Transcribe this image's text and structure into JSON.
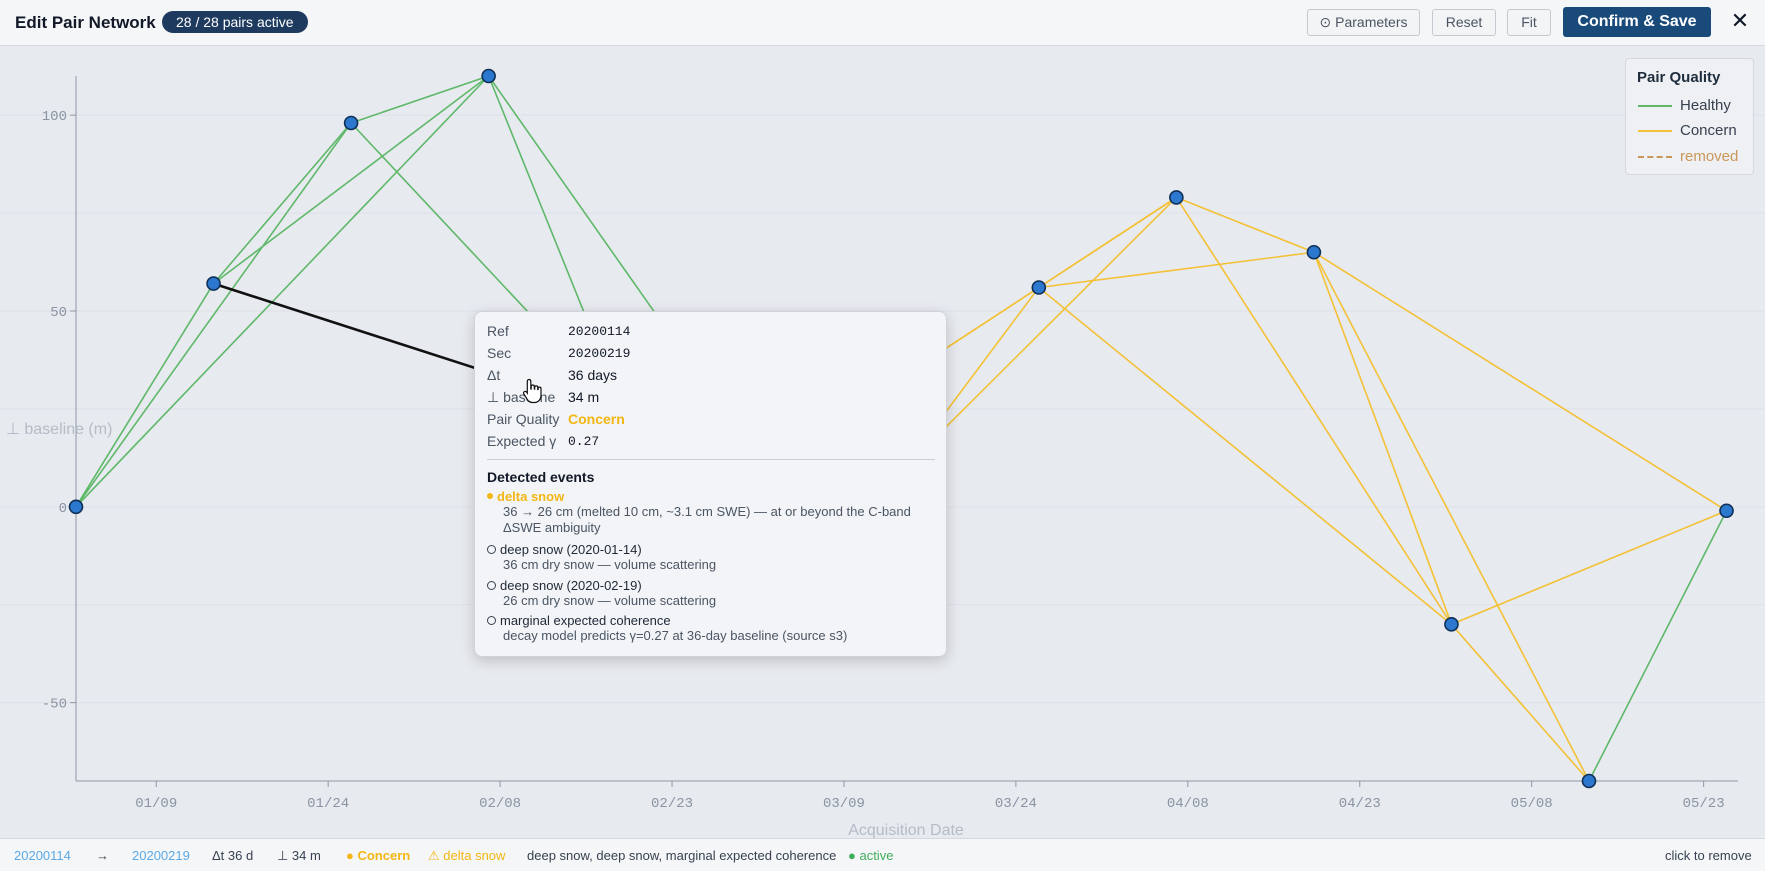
{
  "header": {
    "title": "Edit Pair Network",
    "badge": "28 / 28 pairs active",
    "parameters_label": "⊙ Parameters",
    "reset_label": "Reset",
    "fit_label": "Fit",
    "confirm_label": "Confirm & Save",
    "close_label": "✕"
  },
  "colors": {
    "healthy": "#5fb86a",
    "concern": "#f4c136",
    "removed": "#c9975a",
    "node_fill": "#2c78cf",
    "node_stroke": "#0f2f57",
    "selected_edge": "#111111",
    "confirm_button": "#1a4a7a"
  },
  "legend": {
    "title": "Pair Quality",
    "items": [
      {
        "label": "Healthy",
        "color": "#5fb86a",
        "style": "solid"
      },
      {
        "label": "Concern",
        "color": "#f4c136",
        "style": "solid"
      },
      {
        "label": "removed",
        "color": "#c9975a",
        "style": "dashed"
      }
    ]
  },
  "chart_data": {
    "type": "network",
    "xlabel": "Acquisition Date",
    "ylabel": "⊥ baseline (m)",
    "x_ticks": [
      "01/09",
      "01/24",
      "02/08",
      "02/23",
      "03/09",
      "03/24",
      "04/08",
      "04/23",
      "05/08",
      "05/23"
    ],
    "y_ticks": [
      -50,
      0,
      50,
      100
    ],
    "ylim": [
      -70,
      110
    ],
    "x_domain": [
      "2020-01-02",
      "2020-05-26"
    ],
    "grid": true,
    "nodes": [
      {
        "date": "2020-01-02",
        "baseline": 0
      },
      {
        "date": "2020-01-14",
        "baseline": 57
      },
      {
        "date": "2020-01-26",
        "baseline": 98
      },
      {
        "date": "2020-02-07",
        "baseline": 110
      },
      {
        "date": "2020-02-19",
        "baseline": 23
      },
      {
        "date": "2020-03-02",
        "baseline": 10
      },
      {
        "date": "2020-03-14",
        "baseline": 9
      },
      {
        "date": "2020-03-26",
        "baseline": 56
      },
      {
        "date": "2020-04-07",
        "baseline": 79
      },
      {
        "date": "2020-04-19",
        "baseline": 65
      },
      {
        "date": "2020-05-01",
        "baseline": -30
      },
      {
        "date": "2020-05-13",
        "baseline": -70
      },
      {
        "date": "2020-05-25",
        "baseline": -1
      }
    ],
    "edges": [
      {
        "ref": "2020-01-02",
        "sec": "2020-01-14",
        "quality": "healthy"
      },
      {
        "ref": "2020-01-02",
        "sec": "2020-01-26",
        "quality": "healthy"
      },
      {
        "ref": "2020-01-02",
        "sec": "2020-02-07",
        "quality": "healthy"
      },
      {
        "ref": "2020-01-14",
        "sec": "2020-01-26",
        "quality": "healthy"
      },
      {
        "ref": "2020-01-14",
        "sec": "2020-02-07",
        "quality": "healthy"
      },
      {
        "ref": "2020-01-14",
        "sec": "2020-02-19",
        "quality": "concern",
        "selected": true
      },
      {
        "ref": "2020-01-26",
        "sec": "2020-02-07",
        "quality": "healthy"
      },
      {
        "ref": "2020-01-26",
        "sec": "2020-02-19",
        "quality": "healthy"
      },
      {
        "ref": "2020-02-07",
        "sec": "2020-02-19",
        "quality": "healthy"
      },
      {
        "ref": "2020-02-07",
        "sec": "2020-03-02",
        "quality": "healthy"
      },
      {
        "ref": "2020-02-19",
        "sec": "2020-03-02",
        "quality": "healthy"
      },
      {
        "ref": "2020-02-19",
        "sec": "2020-03-14",
        "quality": "healthy"
      },
      {
        "ref": "2020-03-02",
        "sec": "2020-03-14",
        "quality": "concern"
      },
      {
        "ref": "2020-03-02",
        "sec": "2020-03-26",
        "quality": "concern"
      },
      {
        "ref": "2020-03-14",
        "sec": "2020-03-26",
        "quality": "concern"
      },
      {
        "ref": "2020-03-14",
        "sec": "2020-04-07",
        "quality": "concern"
      },
      {
        "ref": "2020-03-02",
        "sec": "2020-04-07",
        "quality": "concern"
      },
      {
        "ref": "2020-03-26",
        "sec": "2020-04-07",
        "quality": "concern"
      },
      {
        "ref": "2020-03-26",
        "sec": "2020-04-19",
        "quality": "concern"
      },
      {
        "ref": "2020-03-26",
        "sec": "2020-05-01",
        "quality": "concern"
      },
      {
        "ref": "2020-04-07",
        "sec": "2020-04-19",
        "quality": "concern"
      },
      {
        "ref": "2020-04-07",
        "sec": "2020-05-01",
        "quality": "concern"
      },
      {
        "ref": "2020-04-19",
        "sec": "2020-05-01",
        "quality": "concern"
      },
      {
        "ref": "2020-04-19",
        "sec": "2020-05-13",
        "quality": "concern"
      },
      {
        "ref": "2020-04-19",
        "sec": "2020-05-25",
        "quality": "concern"
      },
      {
        "ref": "2020-05-01",
        "sec": "2020-05-13",
        "quality": "concern"
      },
      {
        "ref": "2020-05-01",
        "sec": "2020-05-25",
        "quality": "concern"
      },
      {
        "ref": "2020-05-13",
        "sec": "2020-05-25",
        "quality": "healthy"
      }
    ]
  },
  "tooltip": {
    "ref_key": "Ref",
    "ref_val": "20200114",
    "sec_key": "Sec",
    "sec_val": "20200219",
    "dt_key": "Δt",
    "dt_val": "36 days",
    "bperp_key": "⊥ baseline",
    "bperp_val": "34 m",
    "quality_key": "Pair Quality",
    "quality_val": "Concern",
    "coh_key": "Expected γ",
    "coh_val": "0.27",
    "events_title": "Detected events",
    "events": [
      {
        "title": "delta snow",
        "detail": "36 → 26 cm (melted 10 cm, ~3.1 cm SWE) — at or beyond the C-band ΔSWE ambiguity",
        "warn": true
      },
      {
        "title": "deep snow (2020-01-14)",
        "detail": "36 cm dry snow — volume scattering",
        "warn": false
      },
      {
        "title": "deep snow (2020-02-19)",
        "detail": "26 cm dry snow — volume scattering",
        "warn": false
      },
      {
        "title": "marginal expected coherence",
        "detail": "decay model predicts γ=0.27 at 36-day baseline (source s3)",
        "warn": false
      }
    ]
  },
  "statusbar": {
    "ref": "20200114",
    "arrow": "→",
    "sec": "20200219",
    "dt": "Δt 36 d",
    "bperp": "⊥ 34 m",
    "quality": "● Concern",
    "warning": "⚠ delta snow",
    "events": "deep snow, deep snow, marginal expected coherence",
    "state": "● active",
    "hint": "click to remove"
  }
}
